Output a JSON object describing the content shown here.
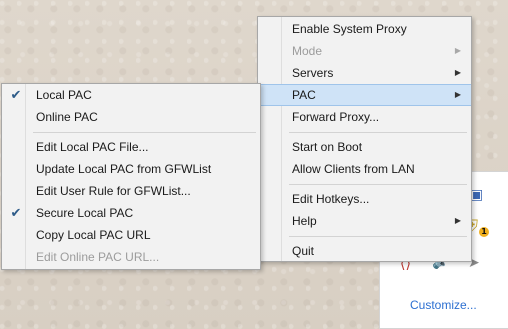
{
  "main_menu": {
    "items": [
      {
        "label": "Enable System Proxy"
      },
      {
        "label": "Mode",
        "disabled": true
      },
      {
        "label": "Servers"
      },
      {
        "label": "PAC",
        "active": true
      },
      {
        "label": "Forward Proxy..."
      },
      {
        "label": "Start on Boot"
      },
      {
        "label": "Allow Clients from LAN"
      },
      {
        "label": "Edit Hotkeys..."
      },
      {
        "label": "Help"
      },
      {
        "label": "Quit"
      }
    ]
  },
  "submenu": {
    "items": [
      {
        "label": "Local PAC",
        "checked": true
      },
      {
        "label": "Online PAC"
      },
      {
        "label": "Edit Local PAC File..."
      },
      {
        "label": "Update Local PAC from GFWList"
      },
      {
        "label": "Edit User Rule for GFWList..."
      },
      {
        "label": "Secure Local PAC",
        "checked": true
      },
      {
        "label": "Copy Local PAC URL"
      },
      {
        "label": "Edit Online PAC URL...",
        "disabled": true
      }
    ]
  },
  "tray_panel": {
    "customize_label": "Customize...",
    "badge_text": "1",
    "icons": [
      "monitor-icon",
      "shield-icon",
      "bracket-icon",
      "speaker-icon",
      "arrow-icon"
    ]
  },
  "colors": {
    "accent_highlight": "#cfe3f7",
    "check_color": "#2d5b88",
    "link_color": "#2c6fd1"
  }
}
